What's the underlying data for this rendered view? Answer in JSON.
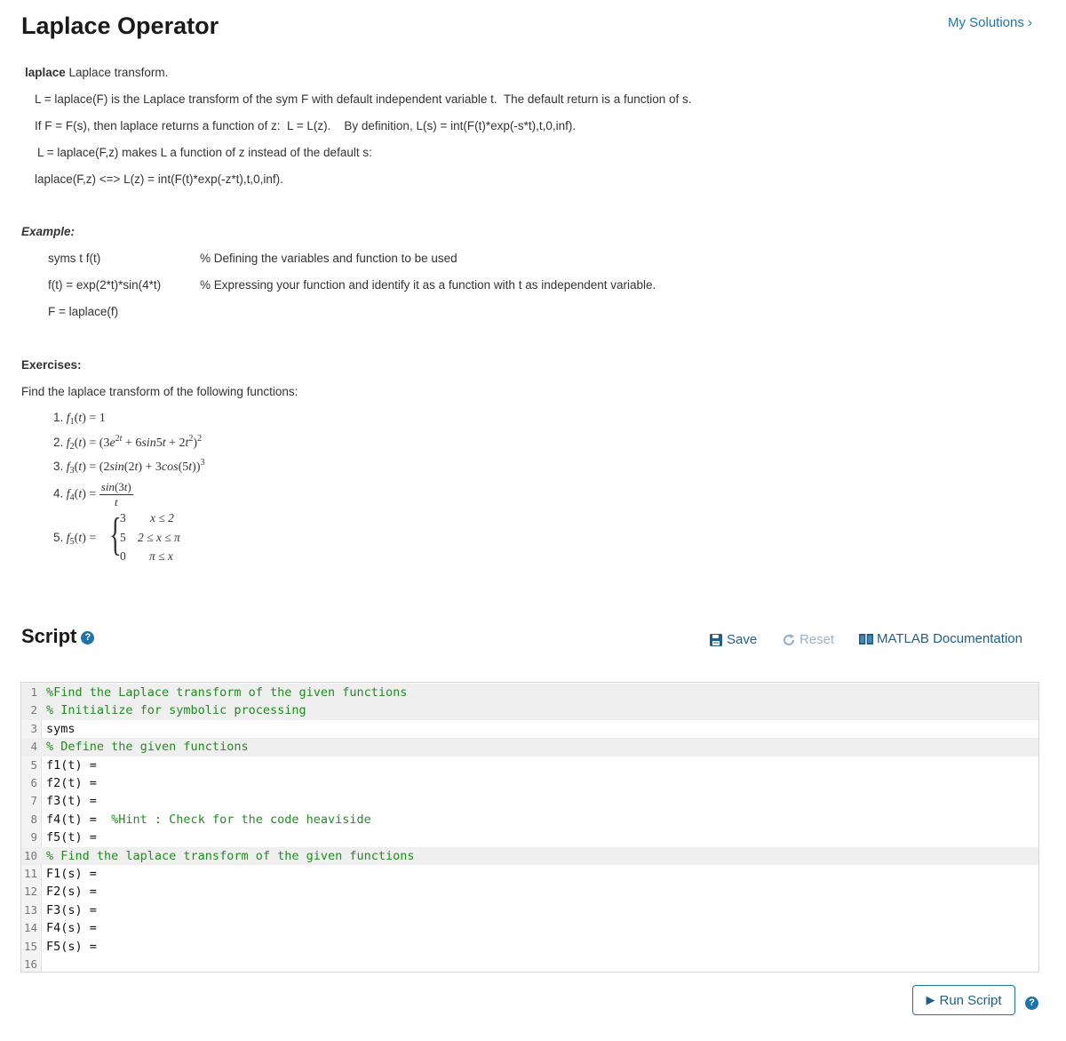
{
  "header": {
    "title": "Laplace Operator",
    "my_solutions": "My Solutions",
    "chevron": "›"
  },
  "description": {
    "intro_bold": "laplace",
    "intro_rest": " Laplace transform.",
    "lines": [
      "L = laplace(F) is the Laplace transform of the sym F with default independent variable t.  The default return is a function of s.",
      "If F = F(s), then laplace returns a function of z:  L = L(z).    By definition, L(s) = int(F(t)*exp(-s*t),t,0,inf).",
      "L = laplace(F,z) makes L a function of z instead of the default s:",
      "laplace(F,z) <=> L(z) = int(F(t)*exp(-z*t),t,0,inf)."
    ]
  },
  "example": {
    "heading": "Example:",
    "rows": [
      {
        "code": "syms t f(t)",
        "comment": "% Defining the variables and function to be used"
      },
      {
        "code": "f(t) = exp(2*t)*sin(4*t)",
        "comment": "% Expressing your function and identify it as a function with t as independent variable."
      },
      {
        "code": "F = laplace(f)",
        "comment": ""
      }
    ]
  },
  "exercises": {
    "heading": "Exercises:",
    "prompt": "Find the laplace transform of the following functions:",
    "items": [
      {
        "num": "1.",
        "label": "f1(t) = 1"
      },
      {
        "num": "2.",
        "label": "f2(t) = (3e^{2t} + 6sin5t + 2t^2)^2"
      },
      {
        "num": "3.",
        "label": "f3(t) = (2sin(2t) + 3cos(5t))^3"
      },
      {
        "num": "4.",
        "label": "f4(t) = sin(3t)/t"
      },
      {
        "num": "5.",
        "label": "f5(t) = {3, x≤2; 5, 2≤x≤π; 0, π≤x}"
      }
    ],
    "f5_cases": [
      {
        "value": "3",
        "cond": "x ≤ 2"
      },
      {
        "value": "5",
        "cond": "2 ≤ x ≤ π"
      },
      {
        "value": "0",
        "cond": "π ≤ x"
      }
    ]
  },
  "script": {
    "title": "Script",
    "help": "?",
    "save_label": "Save",
    "reset_label": "Reset",
    "doc_label": "MATLAB Documentation",
    "run_label": "Run Script",
    "lines": [
      {
        "n": "1",
        "code": "",
        "comment": "%Find the Laplace transform of the given functions",
        "hl": true
      },
      {
        "n": "2",
        "code": "",
        "comment": "% Initialize for symbolic processing",
        "hl": true
      },
      {
        "n": "3",
        "code": "syms",
        "comment": "",
        "hl": false
      },
      {
        "n": "4",
        "code": "",
        "comment": "% Define the given functions",
        "hl": true
      },
      {
        "n": "5",
        "code": "f1(t) =",
        "comment": "",
        "hl": false
      },
      {
        "n": "6",
        "code": "f2(t) =",
        "comment": "",
        "hl": false
      },
      {
        "n": "7",
        "code": "f3(t) =",
        "comment": "",
        "hl": false
      },
      {
        "n": "8",
        "code": "f4(t) =  ",
        "comment": "%Hint : Check for the code heaviside",
        "hl": false
      },
      {
        "n": "9",
        "code": "f5(t) =",
        "comment": "",
        "hl": false
      },
      {
        "n": "10",
        "code": "",
        "comment": "% Find the laplace transform of the given functions",
        "hl": true
      },
      {
        "n": "11",
        "code": "F1(s) =",
        "comment": "",
        "hl": false
      },
      {
        "n": "12",
        "code": "F2(s) =",
        "comment": "",
        "hl": false
      },
      {
        "n": "13",
        "code": "F3(s) =",
        "comment": "",
        "hl": false
      },
      {
        "n": "14",
        "code": "F4(s) =",
        "comment": "",
        "hl": false
      },
      {
        "n": "15",
        "code": "F5(s) =",
        "comment": "",
        "hl": false
      },
      {
        "n": "16",
        "code": "",
        "comment": "",
        "hl": false
      }
    ]
  },
  "colors": {
    "accent": "#1f73a8",
    "comment": "#228b22",
    "reset_disabled": "#9ab3c6"
  }
}
